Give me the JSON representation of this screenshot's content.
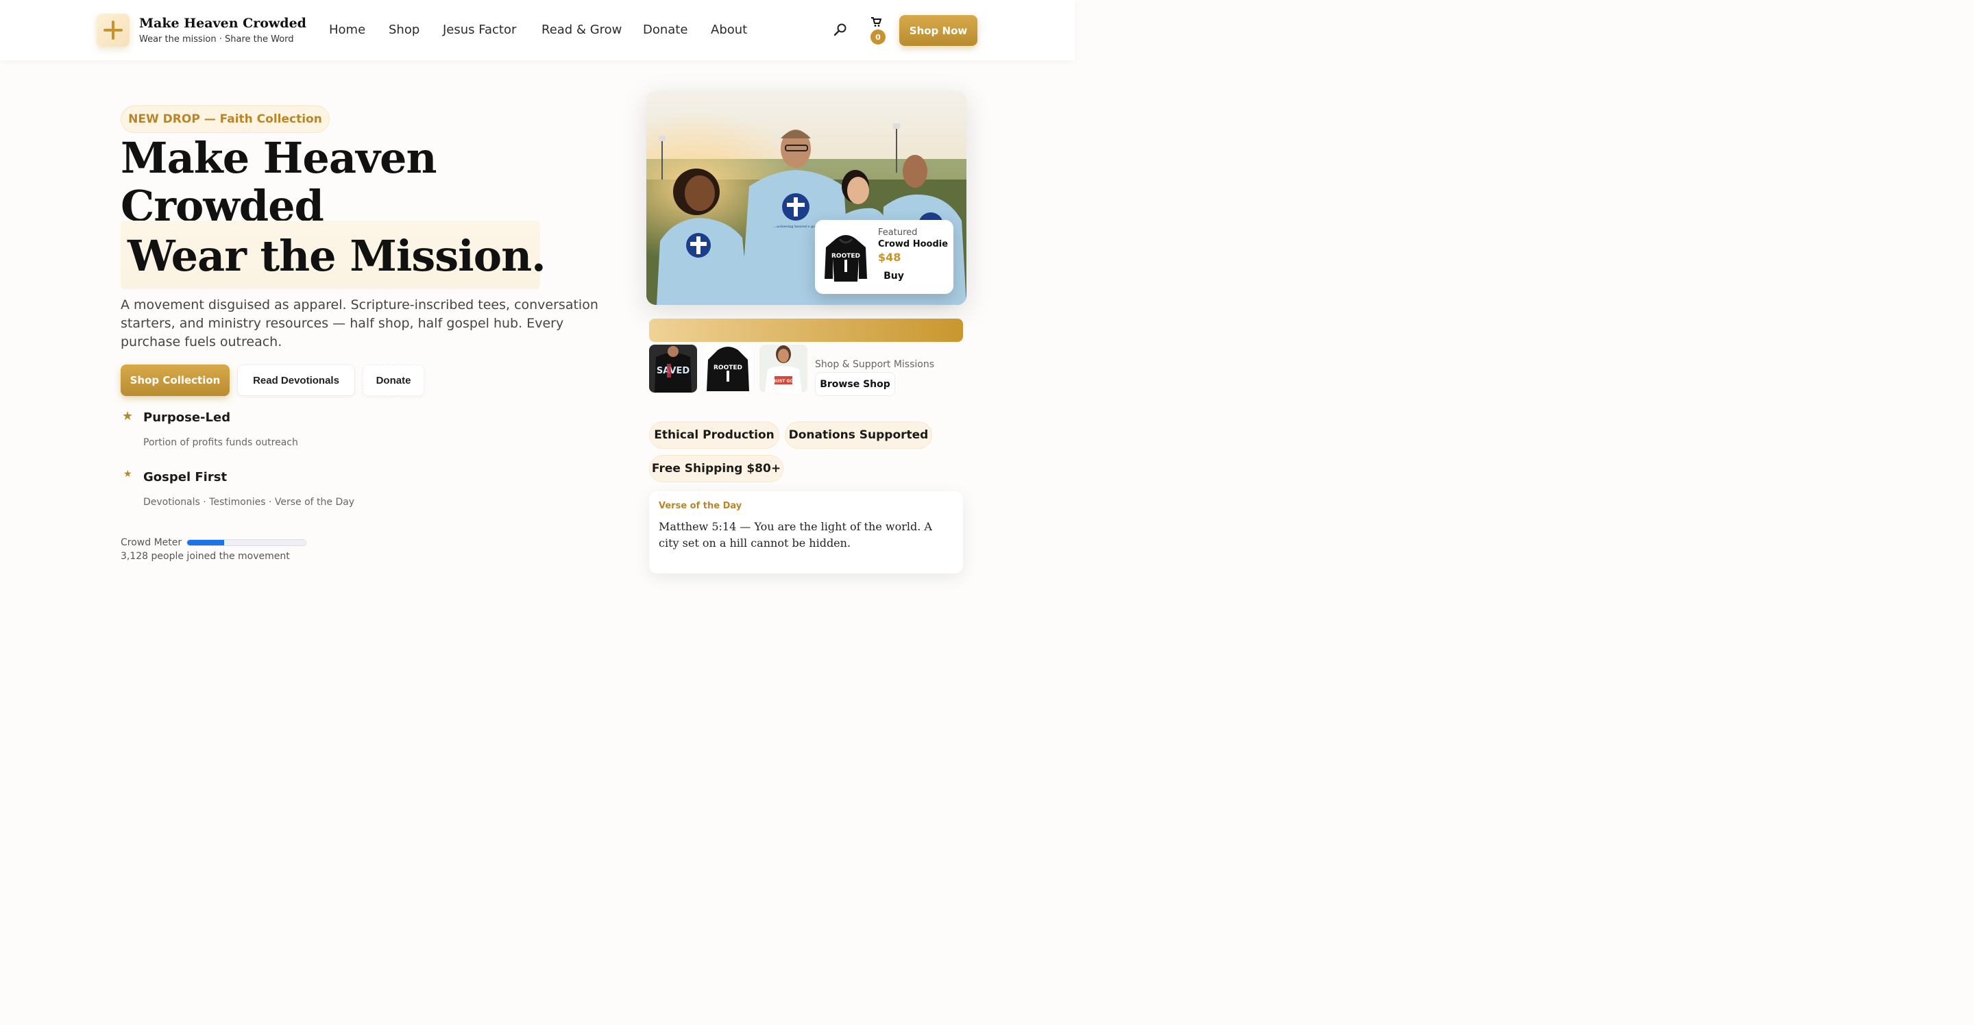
{
  "header": {
    "brand_name": "Make Heaven Crowded",
    "brand_tagline": "Wear the mission · Share the Word",
    "nav": [
      {
        "label": "Home"
      },
      {
        "label": "Shop"
      },
      {
        "label": "Jesus Factor"
      },
      {
        "label": "Read & Grow"
      },
      {
        "label": "Donate"
      },
      {
        "label": "About"
      }
    ],
    "cart_count": "0",
    "shop_now_label": "Shop Now",
    "icons": [
      "plus-logo-icon",
      "search-icon",
      "cart-icon"
    ]
  },
  "hero": {
    "badge": "NEW DROP — Faith Collection",
    "title_line1": "Make Heaven",
    "title_line2": "Crowded",
    "title_line3": "Wear the Mission.",
    "description": "A movement disguised as apparel. Scripture-inscribed tees, conversation starters, and ministry resources — half shop, half gospel hub. Every purchase fuels outreach.",
    "buttons": {
      "shop_collection": "Shop Collection",
      "read_devotionals": "Read Devotionals",
      "donate": "Donate"
    },
    "features": [
      {
        "title": "Purpose-Led",
        "subtitle": "Portion of profits funds outreach"
      },
      {
        "title": "Gospel First",
        "subtitle": "Devotionals · Testimonies · Verse of the Day"
      }
    ],
    "crowd_meter": {
      "label": "Crowd Meter",
      "progress": 0.31,
      "count_text": "3,128 people joined the movement"
    }
  },
  "featured": {
    "label": "Featured",
    "name": "Crowd Hoodie",
    "price": "$48",
    "buy_label": "Buy",
    "hoodie_text": "ROOTED"
  },
  "shirt_print": "...achieving heaven's goal",
  "thumbnails": [
    {
      "name": "saved-tee",
      "text": "SAVED"
    },
    {
      "name": "rooted-hoodie",
      "text": "ROOTED"
    },
    {
      "name": "woman-tee",
      "text": "TRUST GOD"
    }
  ],
  "support": {
    "label": "Shop & Support Missions",
    "browse_label": "Browse Shop"
  },
  "tags": [
    "Ethical Production",
    "Donations Supported",
    "Free Shipping $80+"
  ],
  "verse": {
    "label": "Verse of the Day",
    "text": "Matthew 5:14 — You are the light of the world. A city set on a hill cannot be hidden."
  },
  "colors": {
    "accent_gold": "#c8932e",
    "gold_light": "#efd296",
    "pill_bg": "#fdf3e4",
    "progress_blue": "#1a73e8",
    "heading": "#111111"
  }
}
